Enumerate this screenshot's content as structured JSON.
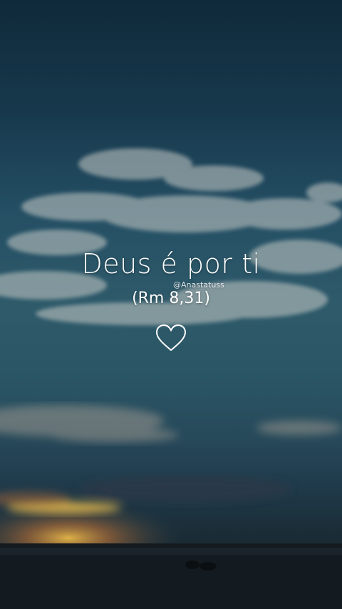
{
  "quote": {
    "text": "Deus é por ti",
    "reference": "(Rm 8,31)",
    "watermark": "@Anastatuss"
  },
  "icons": {
    "heart": "heart-outline-icon"
  },
  "colors": {
    "text": "#ffffff",
    "sky_top": "#0f2a3a",
    "sky_mid": "#2e5a6a",
    "sunset": "#e8a53a"
  }
}
